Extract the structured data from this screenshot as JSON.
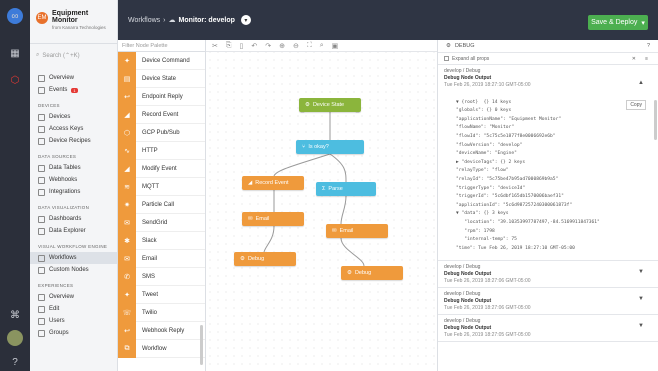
{
  "colors": {
    "rail": "#2b2f3a",
    "topbar": "#2f3544",
    "deploy": "#4caf50",
    "orange": "#ef9a3c",
    "green": "#8bb53c",
    "blue": "#4dbde0"
  },
  "app": {
    "name": "Equipment Monitor",
    "org": "from Kanarra Technologies"
  },
  "search": {
    "placeholder": "Search (⌃+K)"
  },
  "nav": {
    "top": [
      {
        "label": "Overview"
      },
      {
        "label": "Events",
        "badge": "1"
      }
    ],
    "devices": {
      "title": "DEVICES",
      "items": [
        "Devices",
        "Access Keys",
        "Device Recipes"
      ]
    },
    "data": {
      "title": "DATA SOURCES",
      "items": [
        "Data Tables",
        "Webhooks",
        "Integrations"
      ]
    },
    "viz": {
      "title": "DATA VISUALIZATION",
      "items": [
        "Dashboards",
        "Data Explorer"
      ]
    },
    "vwe": {
      "title": "VISUAL WORKFLOW ENGINE",
      "items": [
        "Workflows",
        "Custom Nodes"
      ]
    },
    "exp": {
      "title": "EXPERIENCES",
      "items": [
        "Overview",
        "Edit",
        "Users",
        "Groups"
      ]
    }
  },
  "topbar": {
    "crumb1": "Workflows",
    "sep": "›",
    "crumb2": "Monitor: develop",
    "deploy": "Save & Deploy"
  },
  "palette": {
    "filter": "Filter Node Palette",
    "items": [
      "Device Command",
      "Device State",
      "Endpoint Reply",
      "Record Event",
      "GCP Pub/Sub",
      "HTTP",
      "Modify Event",
      "MQTT",
      "Particle Call",
      "SendGrid",
      "Slack",
      "Email",
      "SMS",
      "Tweet",
      "Twilio",
      "Webhook Reply",
      "Workflow"
    ]
  },
  "nodes": {
    "device_state": "Device State",
    "is_okay": "Is okay?",
    "record_event": "Record Event",
    "parse": "Parse",
    "email1": "Email",
    "email2": "Email",
    "debug1": "Debug",
    "debug2": "Debug"
  },
  "debug": {
    "title": "DEBUG",
    "expand": "Expand all props",
    "copy": "Copy",
    "msg": {
      "path": "develop / Debug",
      "name": "Debug Node Output",
      "time": "Tue Feb 26, 2019 18:27:10 GMT-05:00"
    },
    "root": "▼ {root}  {} 14 keys",
    "lines": [
      "\"globals\": {} 0 keys",
      "\"applicationName\": \"Equipment Monitor\"",
      "\"flowName\": \"Monitor\"",
      "\"flowId\": \"5c75c5e1877f8e0006692e6b\"",
      "\"flowVersion\": \"develop\"",
      "\"deviceName\": \"Engine\"",
      "▶ \"deviceTags\": {} 2 keys",
      "\"relayType\": \"flow\"",
      "\"relayId\": \"5c75be47b95ad7000869b9a5\"",
      "\"triggerType\": \"deviceId\"",
      "\"triggerId\": \"5c6dbf165db1570006baef31\"",
      "\"applicationId\": \"5c6d987257240300061873f\"",
      "▼ \"data\": {} 3 keys",
      "   \"location\": \"39.10353997787497,-84.5169911847361\"",
      "   \"rpm\": 1798",
      "   \"internal-temp\": 75",
      "\"time\": Tue Feb 26, 2019 18:27:10 GMT-05:00"
    ],
    "older": [
      {
        "path": "develop / Debug",
        "name": "Debug Node Output",
        "time": "Tue Feb 26, 2019 18:27:06 GMT-05:00"
      },
      {
        "path": "develop / Debug",
        "name": "Debug Node Output",
        "time": "Tue Feb 26, 2019 18:27:06 GMT-05:00"
      },
      {
        "path": "develop / Debug",
        "name": "Debug Node Output",
        "time": "Tue Feb 26, 2019 18:27:05 GMT-05:00"
      }
    ]
  }
}
